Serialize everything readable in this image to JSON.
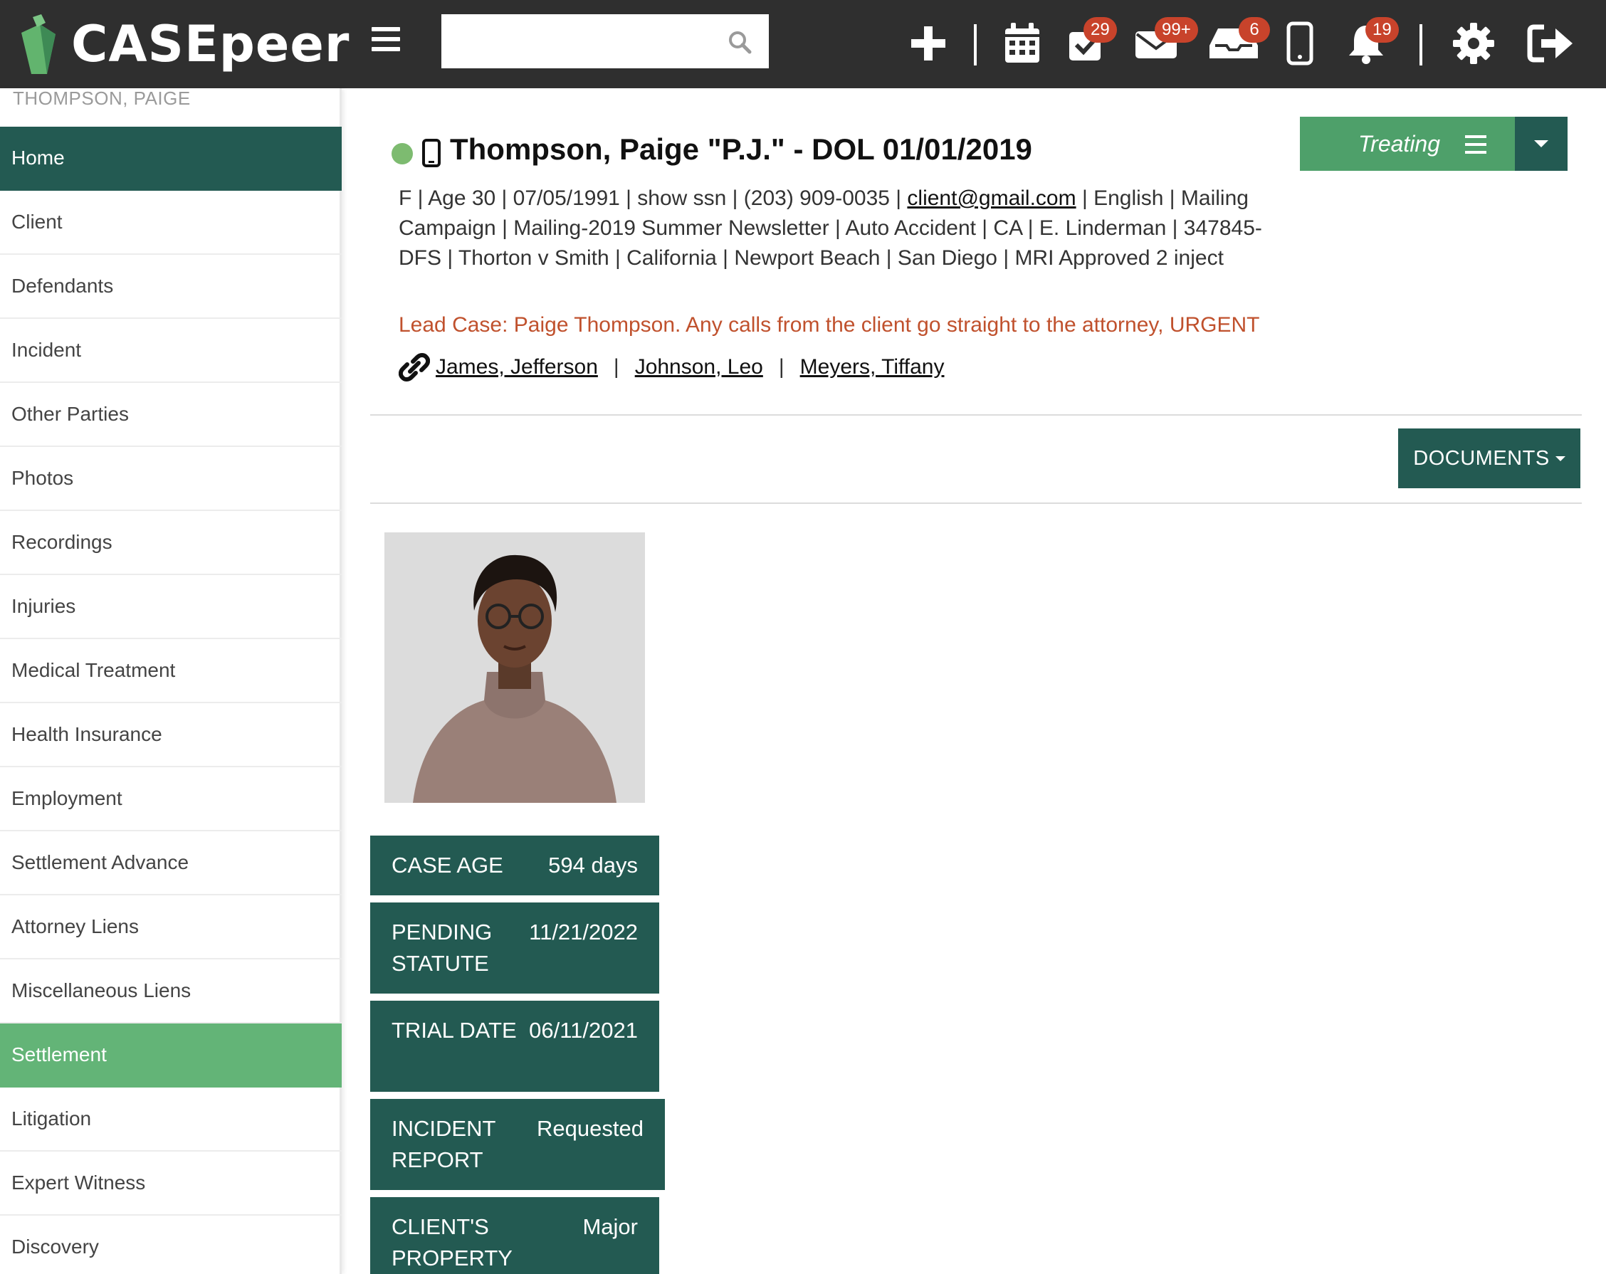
{
  "app": {
    "name": "CASEpeer"
  },
  "search": {
    "placeholder": "",
    "value": ""
  },
  "toolbar": {
    "badges": {
      "tasks": "29",
      "mail": "99+",
      "inbox": "6",
      "notifications": "19"
    }
  },
  "sidebar": {
    "client_name": "THOMPSON, PAIGE",
    "items": [
      {
        "label": "Home"
      },
      {
        "label": "Client"
      },
      {
        "label": "Defendants"
      },
      {
        "label": "Incident"
      },
      {
        "label": "Other Parties"
      },
      {
        "label": "Photos"
      },
      {
        "label": "Recordings"
      },
      {
        "label": "Injuries"
      },
      {
        "label": "Medical Treatment"
      },
      {
        "label": "Health Insurance"
      },
      {
        "label": "Employment"
      },
      {
        "label": "Settlement Advance"
      },
      {
        "label": "Attorney Liens"
      },
      {
        "label": "Miscellaneous Liens"
      },
      {
        "label": "Settlement"
      },
      {
        "label": "Litigation"
      },
      {
        "label": "Expert Witness"
      },
      {
        "label": "Discovery"
      }
    ]
  },
  "case": {
    "title": "Thompson, Paige \"P.J.\" - DOL 01/01/2019",
    "status_label": "Treating",
    "info_line1": "F  |  Age 30   |  07/05/1991  |  show ssn  |  (203) 909-0035  |  ",
    "email": "client@gmail.com",
    "info_line1_end": "  |  English  |",
    "info_rest": "  Mailing Campaign  |  Mailing-2019 Summer Newsletter  |  Auto Accident  |  CA  |  E. Linderman  |  347845-DFS  |  Thorton v Smith  |  California  |  Newport Beach  |  San Diego  |   MRI Approved 2 inject",
    "lead_note": "Lead Case: Paige Thompson. Any calls from the client go straight to the attorney, URGENT",
    "related": [
      "James, Jefferson",
      "Johnson, Leo",
      "Meyers, Tiffany"
    ],
    "documents_label": "DOCUMENTS"
  },
  "stats": [
    {
      "label": "CASE AGE",
      "value": "594 days"
    },
    {
      "label": "PENDING STATUTE",
      "value": "11/21/2022"
    },
    {
      "label": "TRIAL DATE",
      "value": "06/11/2021"
    },
    {
      "label": "INCIDENT REPORT",
      "value": "Requested"
    },
    {
      "label": "CLIENT'S PROPERTY",
      "value": "Major"
    }
  ],
  "colors": {
    "topbar": "#2f2f2f",
    "primary": "#235a52",
    "accent": "#63b477",
    "alert": "#c0512d",
    "badge": "#c8432b"
  }
}
